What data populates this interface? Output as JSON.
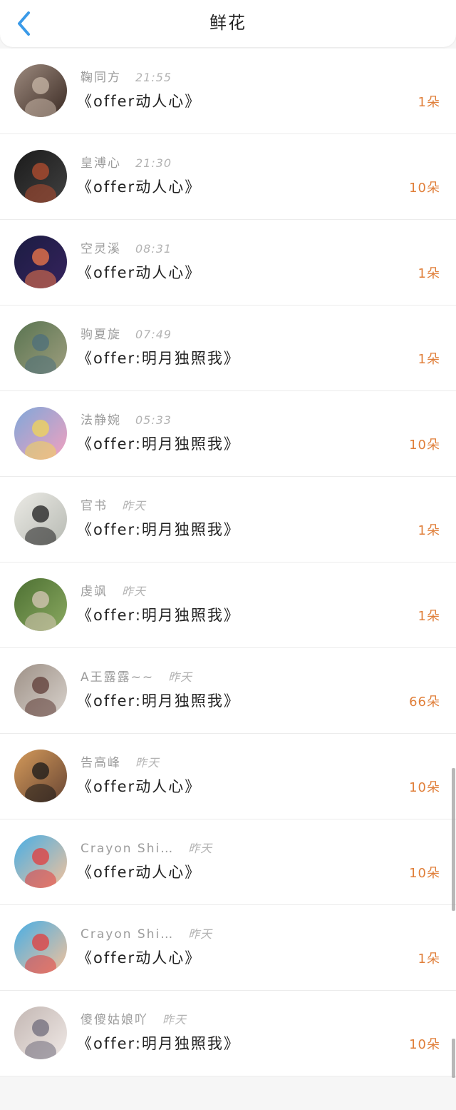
{
  "header": {
    "title": "鲜花"
  },
  "icons": {
    "back": "chevron-left-icon",
    "accent": "#3a9ae8"
  },
  "colors": {
    "count": "#e07f3a"
  },
  "list": {
    "items": [
      {
        "name": "鞠同方",
        "time": "21:55",
        "product": "《offer动人心》",
        "count": "1朵",
        "avatar_colors": [
          "#9d8a7e",
          "#3b2b24",
          "#c8b7a7"
        ]
      },
      {
        "name": "皇溥心",
        "time": "21:30",
        "product": "《offer动人心》",
        "count": "10朵",
        "avatar_colors": [
          "#1b1b1b",
          "#404040",
          "#b54d2f"
        ]
      },
      {
        "name": "空灵溪",
        "time": "08:31",
        "product": "《offer动人心》",
        "count": "1朵",
        "avatar_colors": [
          "#1b1c42",
          "#36235d",
          "#f47a48"
        ]
      },
      {
        "name": "驹夏旋",
        "time": "07:49",
        "product": "《offer:明月独照我》",
        "count": "1朵",
        "avatar_colors": [
          "#597451",
          "#9e9e7e",
          "#4d6f7c"
        ]
      },
      {
        "name": "法静婉",
        "time": "05:33",
        "product": "《offer:明月独照我》",
        "count": "10朵",
        "avatar_colors": [
          "#7fa7d9",
          "#f3a1bf",
          "#f2d657"
        ]
      },
      {
        "name": "官书",
        "time": "昨天",
        "product": "《offer:明月独照我》",
        "count": "1朵",
        "avatar_colors": [
          "#ebeae5",
          "#b7bab3",
          "#1e1e1e"
        ]
      },
      {
        "name": "虔飒",
        "time": "昨天",
        "product": "《offer:明月独照我》",
        "count": "1朵",
        "avatar_colors": [
          "#4d7033",
          "#8aa960",
          "#d8c8b8"
        ]
      },
      {
        "name": "A王露露~~",
        "time": "昨天",
        "product": "《offer:明月独照我》",
        "count": "66朵",
        "avatar_colors": [
          "#9e9187",
          "#d8d2cc",
          "#5d3b35"
        ]
      },
      {
        "name": "告高峰",
        "time": "昨天",
        "product": "《offer动人心》",
        "count": "10朵",
        "avatar_colors": [
          "#d49a5a",
          "#694634",
          "#181818"
        ]
      },
      {
        "name": "Crayon Shi…",
        "time": "昨天",
        "product": "《offer动人心》",
        "count": "10朵",
        "avatar_colors": [
          "#48aee5",
          "#f3c29b",
          "#e33c3c"
        ]
      },
      {
        "name": "Crayon Shi…",
        "time": "昨天",
        "product": "《offer动人心》",
        "count": "1朵",
        "avatar_colors": [
          "#48aee5",
          "#f3c29b",
          "#e33c3c"
        ]
      },
      {
        "name": "傻傻姑娘吖",
        "time": "昨天",
        "product": "《offer:明月独照我》",
        "count": "10朵",
        "avatar_colors": [
          "#c3b7b3",
          "#f0e9e6",
          "#6f6b7b"
        ]
      }
    ]
  }
}
